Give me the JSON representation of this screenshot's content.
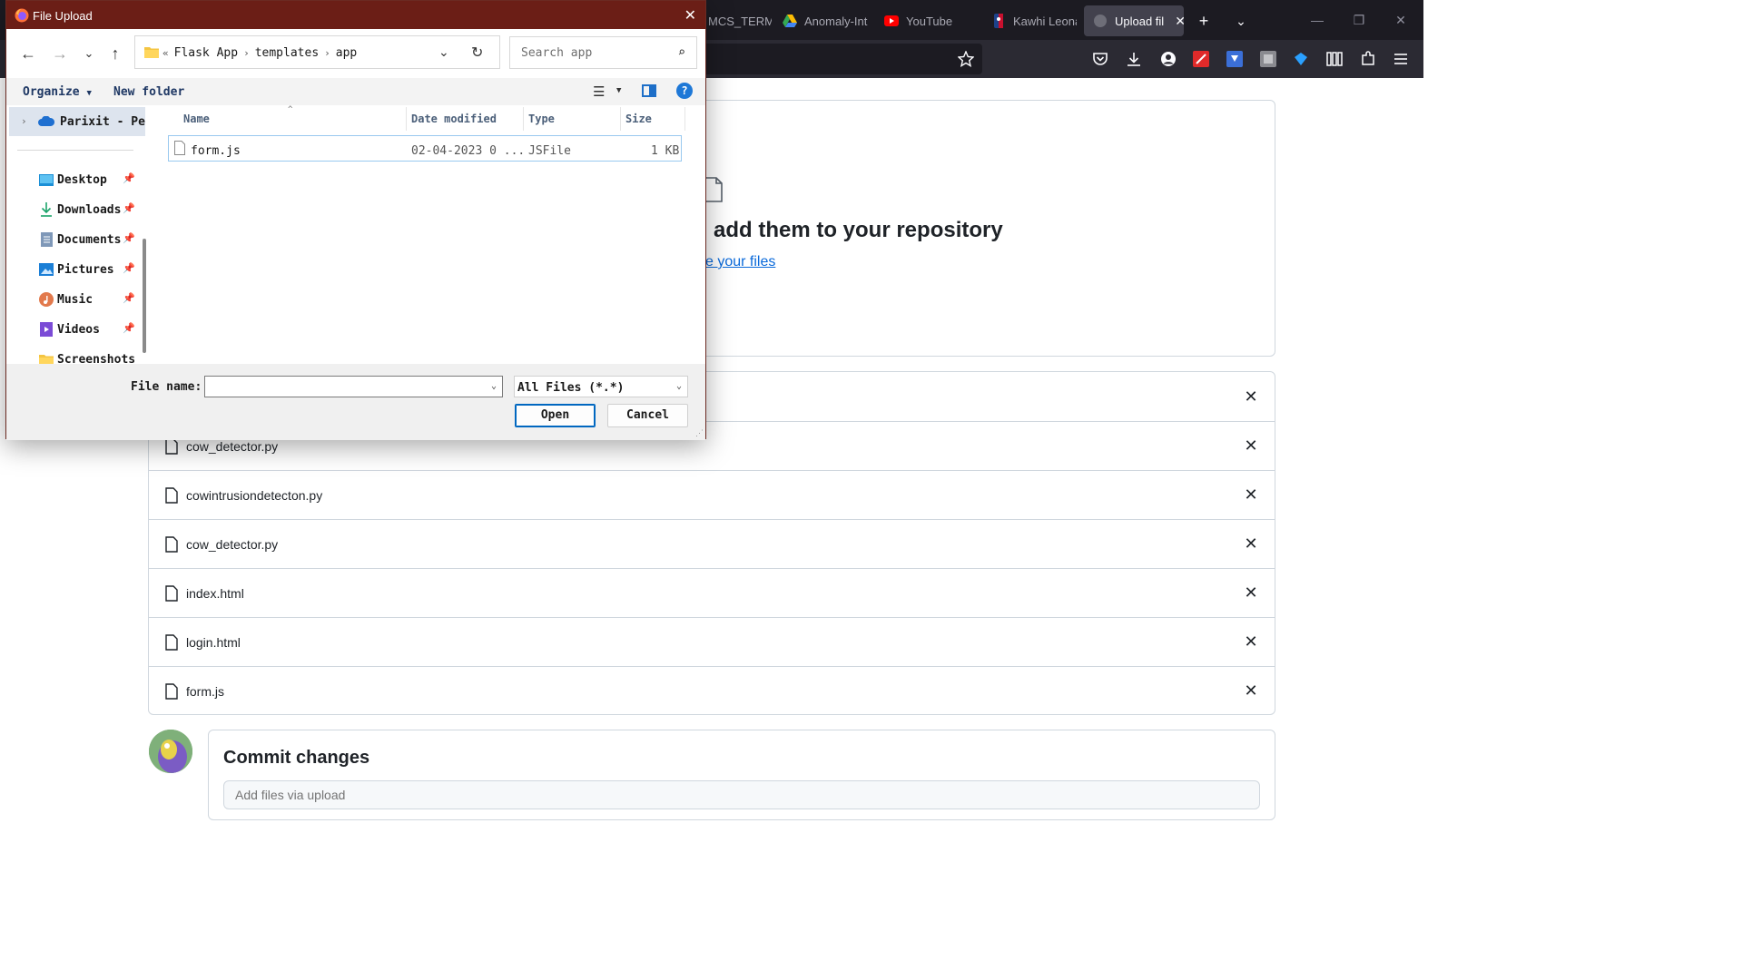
{
  "browser": {
    "tabs": [
      {
        "title": "MCS_TERM",
        "favicon": "partial-tab-icon"
      },
      {
        "title": "Anomaly-Int",
        "favicon": "google-drive-icon"
      },
      {
        "title": "YouTube",
        "favicon": "youtube-icon"
      },
      {
        "title": "Kawhi Leona",
        "favicon": "nba-icon"
      },
      {
        "title": "Upload fil",
        "favicon": "github-icon",
        "active": true
      }
    ],
    "new_tab_icon": "plus-icon",
    "list_tabs_icon": "chevron-down-icon",
    "window_controls": [
      "minimize-icon",
      "restore-icon",
      "close-icon"
    ],
    "toolbar_icons": [
      "bookmark-star-icon",
      "pocket-icon",
      "downloads-icon",
      "account-icon",
      "extension-red-icon",
      "extension-save-icon",
      "extension-gray-icon",
      "extension-blue-icon",
      "library-icon",
      "extensions-icon",
      "menu-icon"
    ]
  },
  "page": {
    "drop_heading": "add them to your repository",
    "drop_link": "e your files",
    "files": [
      "cow_detector.py",
      "cowintrusiondetecton.py",
      "cow_detector.py",
      "index.html",
      "login.html",
      "form.js"
    ],
    "remove_glyph": "✕",
    "commit_title": "Commit changes",
    "commit_placeholder": "Add files via upload"
  },
  "dialog": {
    "title": "File Upload",
    "path_prefix": "«",
    "path": [
      "Flask App",
      "templates",
      "app"
    ],
    "search_placeholder": "Search app",
    "organize": "Organize",
    "new_folder": "New folder",
    "sidebar_root": "Parixit - Pe",
    "sidebar_items": [
      {
        "label": "Desktop",
        "icon": "desktop-icon"
      },
      {
        "label": "Downloads",
        "icon": "download-icon"
      },
      {
        "label": "Documents",
        "icon": "documents-icon"
      },
      {
        "label": "Pictures",
        "icon": "pictures-icon"
      },
      {
        "label": "Music",
        "icon": "music-icon"
      },
      {
        "label": "Videos",
        "icon": "videos-icon"
      },
      {
        "label": "Screenshots",
        "icon": "folder-icon"
      }
    ],
    "columns": {
      "name": "Name",
      "date": "Date modified",
      "type": "Type",
      "size": "Size"
    },
    "file_row": {
      "name": "form.js",
      "date": "02-04-2023 0 ...",
      "type": "JSFile",
      "size": "1 KB"
    },
    "file_name_label": "File name:",
    "file_name_value": "",
    "file_type": "All Files (*.*)",
    "open_label": "Open",
    "cancel_label": "Cancel"
  }
}
